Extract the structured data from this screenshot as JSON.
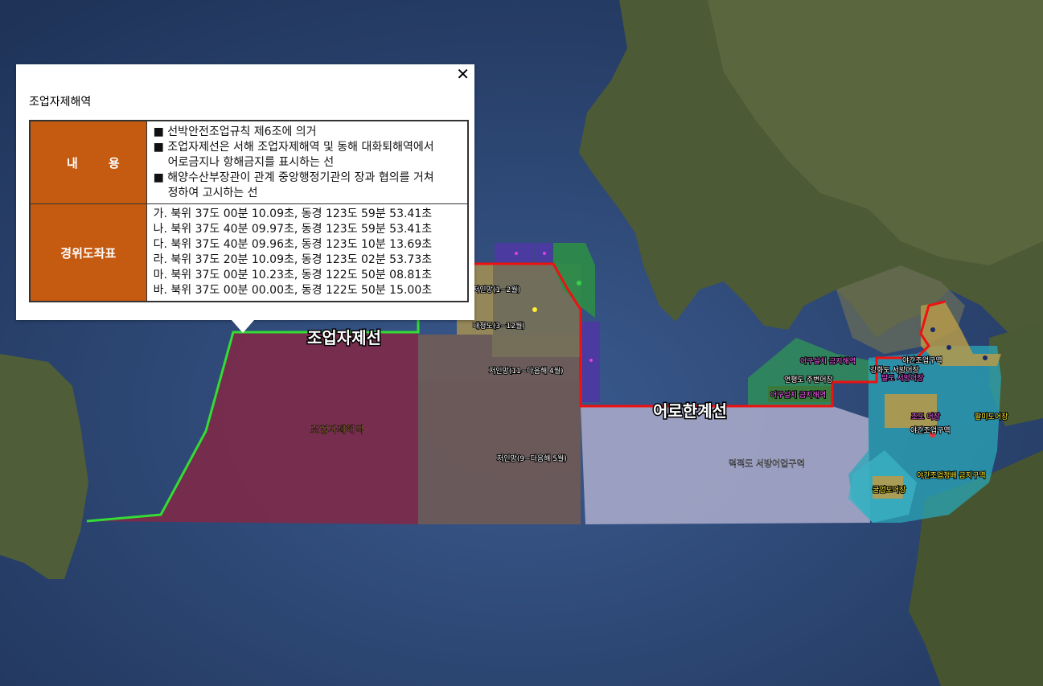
{
  "popup": {
    "title": "조업자제해역",
    "close_glyph": "✕",
    "content_header": "내 용",
    "content_header_chars": [
      "내",
      "용"
    ],
    "content_lines": [
      "■ 선박안전조업규칙 제6조에 의거",
      "■ 조업자제선은 서해 조업자제해역 및 동해 대화퇴해역에서",
      "어로금지나 항해금지를 표시하는 선",
      "■ 해양수산부장관이 관계 중앙행정기관의 장과 협의를 거쳐",
      "정하여 고시하는 선"
    ],
    "coords_header": "경위도좌표",
    "coords": [
      "가. 북위 37도 00분 10.09초, 동경 123도 59분 53.41초",
      "나. 북위 37도 40분 09.97초, 동경 123도 59분 53.41초",
      "다. 북위 37도 40분 09.96초, 동경 123도 10분 13.69초",
      "라. 북위 37도 20분 10.09초, 동경 123도 02분 53.73초",
      "마. 북위 37도 00분 10.23초, 동경 122도 50분 08.81초",
      "바. 북위 37도 00분 00.00초, 동경 122도 50분 15.00초"
    ]
  },
  "map": {
    "line_labels": {
      "restraint_line": "조업자제선",
      "fishing_limit_line": "어로한계선"
    },
    "zone_labels": {
      "restraint_zone": "조업자제해역",
      "jeoinmang_1_2": "저인망(1~2월)",
      "daecheong": "대청도(3~12월)",
      "jeoinmang_11_4": "저인망(11~다음해 4월)",
      "jeoinmang_9_5": "저인망(9~다음해 5월)",
      "deokjeok_west": "덕적도 서방어업구역",
      "ganghwa_west": "강화도 서방어장",
      "yeonpyeong": "연평도 주변어장",
      "night_fishing_a": "야간조업구역",
      "night_fishing_b": "야간조업구역",
      "fishing_ban_a": "어구설치 금지해역",
      "fishing_ban_b": "어구설치 금지해역",
      "fishing_ban_c": "야간조업정배 금지구역",
      "maldo": "말도 서방어장",
      "jodo": "조도 어장",
      "gulup": "굴업도어장",
      "palmido": "팔미도어장"
    },
    "colors": {
      "sea": "#2b4470",
      "restraint_zone": "#7d2a4a",
      "restraint_line": "#33dd33",
      "fishing_limit_line": "#ee1111",
      "header_orange": "#c55a11"
    }
  }
}
